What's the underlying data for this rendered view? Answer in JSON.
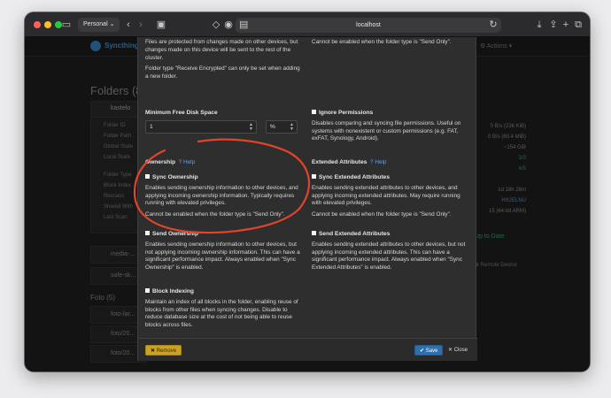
{
  "browser": {
    "profile_label": "Personal",
    "url": "localhost"
  },
  "app": {
    "brand": "Syncthing",
    "actions_label": "Actions",
    "folders_title": "Folders (8)",
    "folder_name": "kastelo",
    "folder_props": [
      "Folder ID",
      "Folder Path",
      "Global State",
      "Local State",
      "Folder Type",
      "Block Index",
      "Rescans",
      "Shared With",
      "Last Scan"
    ],
    "other_folders": [
      "media-...",
      "safe-sk..."
    ],
    "foto_title": "Foto (5)",
    "foto_folders": [
      "foto-lar...",
      "foto/20...",
      "foto/20...",
      "foto/20...",
      "foto/all..."
    ],
    "right_values": [
      "0 B/s (236 KiB)",
      "0 B/s (60.4 MiB)",
      "~154 GiB",
      "3/3",
      "4/5",
      "1d 18h 28m",
      "HX2ELNU",
      "15 (64-bit ARM)"
    ],
    "up_to_date": "Up to Date",
    "remote_device": "Remote Device"
  },
  "modal": {
    "top_left_text": "Files are protected from changes made on other devices, but changes made on this device will be sent to the rest of the cluster.",
    "top_left_note": "Folder type \"Receive Encrypted\" can only be set when adding a new folder.",
    "top_right_text": "Cannot be enabled when the folder type is \"Send Only\".",
    "min_disk": {
      "label": "Minimum Free Disk Space",
      "value": "1",
      "unit": "%"
    },
    "ignore_permissions": {
      "label": "Ignore Permissions",
      "text": "Disables comparing and syncing file permissions. Useful on systems with nonexistent or custom permissions (e.g. FAT, exFAT, Synology, Android)."
    },
    "ownership": {
      "label": "Ownership",
      "help": "Help"
    },
    "extended_attributes": {
      "label": "Extended Attributes",
      "help": "Help"
    },
    "sync_ownership": {
      "label": "Sync Ownership",
      "text": "Enables sending ownership information to other devices, and applying incoming ownership information. Typically requires running with elevated privileges.",
      "note": "Cannot be enabled when the folder type is \"Send Only\"."
    },
    "sync_extended": {
      "label": "Sync Extended Attributes",
      "text": "Enables sending extended attributes to other devices, and applying incoming extended attributes. May require running with elevated privileges.",
      "note": "Cannot be enabled when the folder type is \"Send Only\"."
    },
    "send_ownership": {
      "label": "Send Ownership",
      "text": "Enables sending ownership information to other devices, but not applying incoming ownership information. This can have a significant performance impact. Always enabled when \"Sync Ownership\" is enabled."
    },
    "send_extended": {
      "label": "Send Extended Attributes",
      "text": "Enables sending extended attributes to other devices, but not applying incoming extended attributes. This can have a significant performance impact. Always enabled when \"Sync Extended Attributes\" is enabled."
    },
    "block_indexing": {
      "label": "Block Indexing",
      "text": "Maintain an index of all blocks in the folder, enabling reuse of blocks from other files when syncing changes. Disable to reduce database size at the cost of not being able to reuse blocks across files."
    },
    "buttons": {
      "remove": "Remove",
      "save": "Save",
      "close": "Close"
    }
  },
  "colors": {
    "annotation": "#e0442a",
    "accent": "#5ea3e4",
    "save": "#2f6fae",
    "remove": "#c9a227"
  }
}
